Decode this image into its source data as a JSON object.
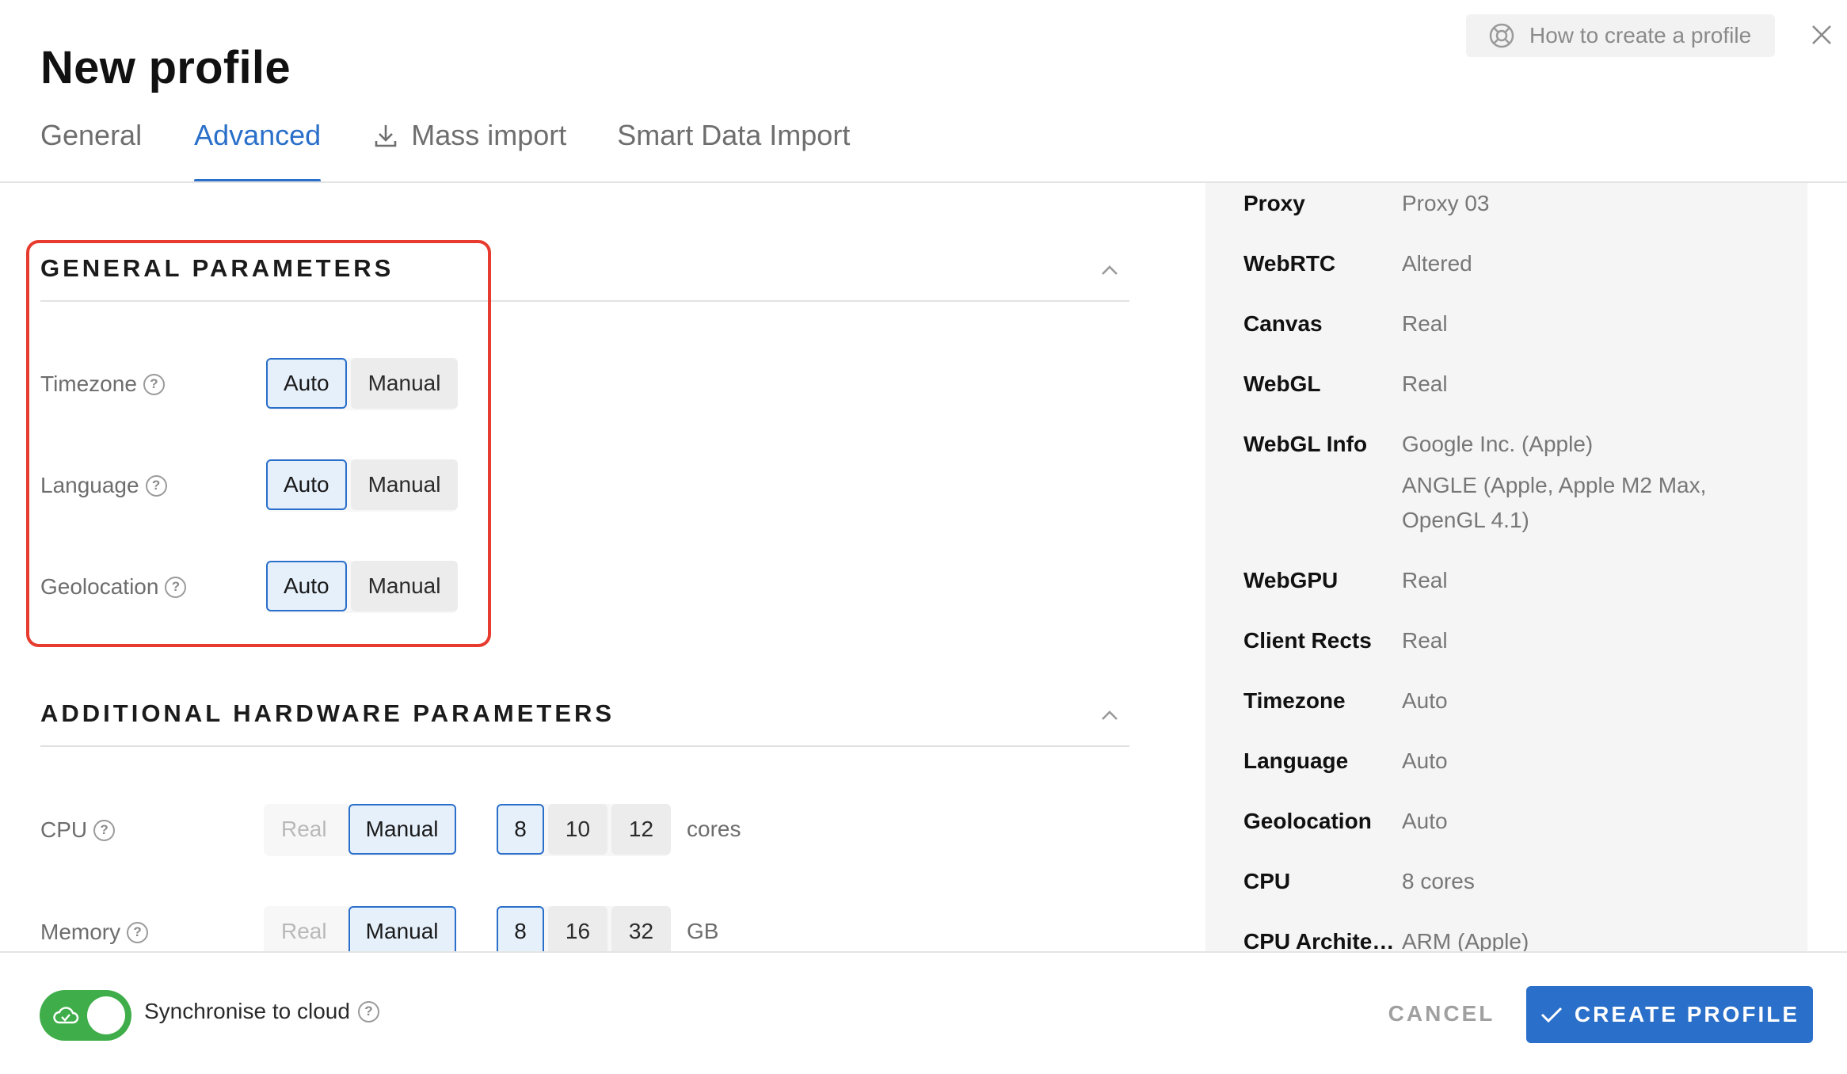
{
  "header": {
    "title": "New profile",
    "help_label": "How to create a profile"
  },
  "tabs": [
    {
      "label": "General",
      "active": false
    },
    {
      "label": "Advanced",
      "active": true
    },
    {
      "label": "Mass import",
      "active": false
    },
    {
      "label": "Smart Data Import",
      "active": false
    }
  ],
  "general": {
    "title": "GENERAL PARAMETERS",
    "rows": [
      {
        "label": "Timezone",
        "options": [
          "Auto",
          "Manual"
        ],
        "selected": "Auto"
      },
      {
        "label": "Language",
        "options": [
          "Auto",
          "Manual"
        ],
        "selected": "Auto"
      },
      {
        "label": "Geolocation",
        "options": [
          "Auto",
          "Manual"
        ],
        "selected": "Auto"
      }
    ]
  },
  "hardware": {
    "title": "ADDITIONAL HARDWARE PARAMETERS",
    "cpu": {
      "label": "CPU",
      "mode_options": [
        "Real",
        "Manual"
      ],
      "mode_selected": "Manual",
      "values": [
        "8",
        "10",
        "12"
      ],
      "value_selected": "8",
      "unit": "cores"
    },
    "memory": {
      "label": "Memory",
      "mode_options": [
        "Real",
        "Manual"
      ],
      "mode_selected": "Manual",
      "values": [
        "8",
        "16",
        "32"
      ],
      "value_selected": "8",
      "unit": "GB"
    }
  },
  "summary": [
    {
      "key": "Proxy",
      "value": "Proxy 03"
    },
    {
      "key": "WebRTC",
      "value": "Altered"
    },
    {
      "key": "Canvas",
      "value": "Real"
    },
    {
      "key": "WebGL",
      "value": "Real"
    },
    {
      "key": "WebGL Info",
      "value": "Google Inc. (Apple)",
      "value2": "ANGLE (Apple, Apple M2 Max, OpenGL 4.1)"
    },
    {
      "key": "WebGPU",
      "value": "Real"
    },
    {
      "key": "Client Rects",
      "value": "Real"
    },
    {
      "key": "Timezone",
      "value": "Auto"
    },
    {
      "key": "Language",
      "value": "Auto"
    },
    {
      "key": "Geolocation",
      "value": "Auto"
    },
    {
      "key": "CPU",
      "value": "8 cores"
    },
    {
      "key": "CPU Architecture",
      "value": "ARM (Apple)"
    }
  ],
  "footer": {
    "sync_label": "Synchronise to cloud",
    "sync_on": true,
    "cancel_label": "CANCEL",
    "create_label": "CREATE PROFILE"
  },
  "colors": {
    "accent": "#2a6fc9",
    "toggle_on": "#3fae4a",
    "highlight": "#e63b2e"
  }
}
